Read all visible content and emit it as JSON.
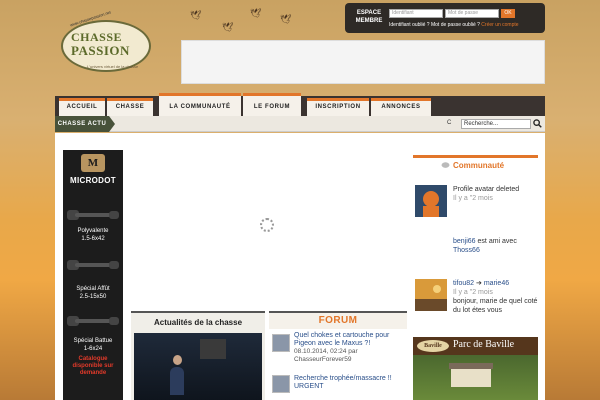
{
  "site": {
    "logo_line1": "CHASSE",
    "logo_line2": "PASSION",
    "logo_url": "www.chassepassion.net",
    "logo_tagline": "L'univers virtuel de la chasse"
  },
  "member": {
    "title_line1": "ESPACE",
    "title_line2": "MEMBRE",
    "id_placeholder": "Identifiant",
    "pw_placeholder": "Mot de passe",
    "ok_label": "OK",
    "forgot_text": "Identifiant oublié ? Mot de passe oublié ?",
    "create_text": "Créer un compte"
  },
  "nav": {
    "items": [
      "ACCUEIL",
      "CHASSE",
      "LA COMMUNAUTÉ",
      "LE FORUM",
      "INSCRIPTION",
      "ANNONCES"
    ]
  },
  "actu_bar": {
    "label": "CHASSE ACTU",
    "ticker": "C",
    "search_value": "Recherche..."
  },
  "left_ad": {
    "logo_letter": "M",
    "brand": "MICRODOT",
    "product1_name": "Polyvalente",
    "product1_spec": "1.5-6x42",
    "product2_name": "Spécial Affût",
    "product2_spec": "2.5-15x50",
    "product3_name": "Spécial Battue",
    "product3_spec": "1-6x24",
    "catalogue": "Catalogue disponible sur demande"
  },
  "actualites": {
    "title": "Actualités de la chasse"
  },
  "forum": {
    "title": "FORUM",
    "posts": [
      {
        "title": "Quel chokes et cartouche pour Pigeon avec le Maxus ?!",
        "date": "08.10.2014, 02:24 par",
        "author": "ChasseurForever59"
      },
      {
        "title": "Recherche trophée/massacre !! URGENT"
      }
    ]
  },
  "communaute": {
    "title": "Communauté",
    "items": [
      {
        "text": "Profile avatar deleted",
        "time": "Il y a \"2 mois"
      },
      {
        "user1": "benji66",
        "text": "est ami avec",
        "user2": "Thoss66"
      },
      {
        "user1": "tifou82",
        "arrow": "➔",
        "user2": "marie46",
        "time": "Il y a \"2 mois",
        "text": "bonjour, marie de quel coté du lot étes vous"
      }
    ]
  },
  "baville": {
    "logo": "Baville",
    "title": "Parc de Baville"
  },
  "colors": {
    "accent": "#e2762a",
    "nav_dark": "#3a3330",
    "actu_green": "#48523a"
  }
}
